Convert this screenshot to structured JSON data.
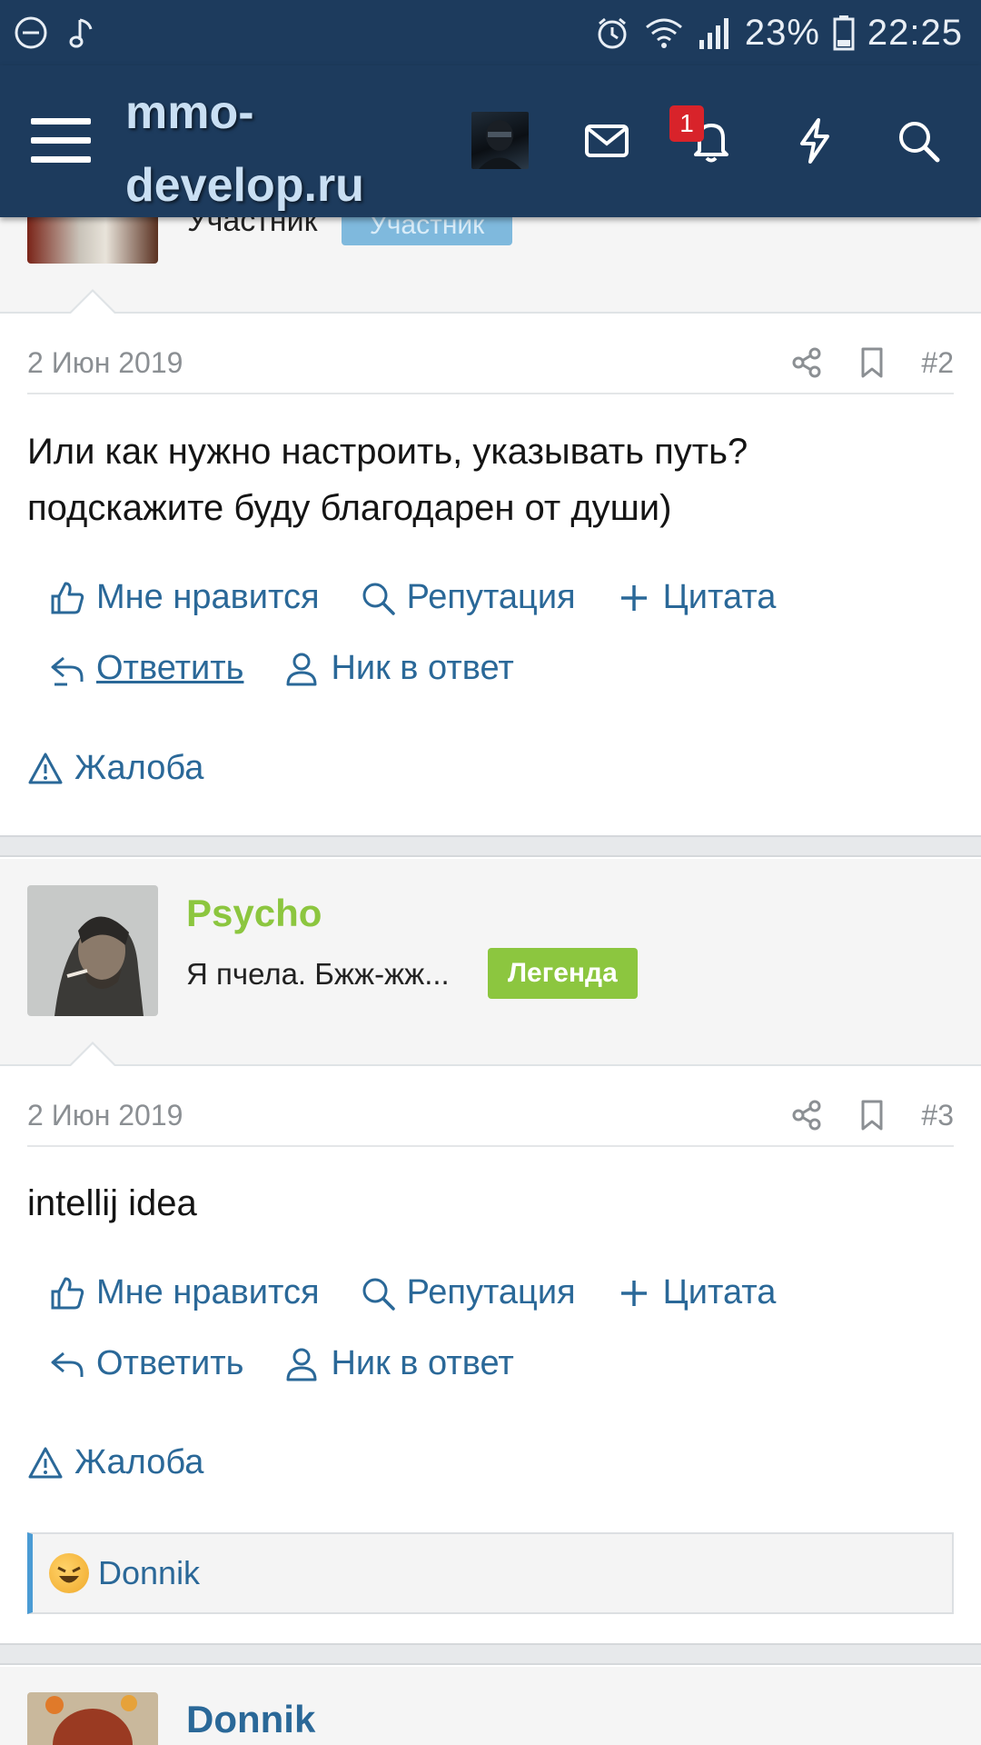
{
  "status_bar": {
    "battery": "23%",
    "time": "22:25"
  },
  "header": {
    "site_title": "mmo-develop.ru",
    "notification_count": "1",
    "icons": [
      "menu-icon",
      "avatar",
      "mail-icon",
      "bell-icon",
      "lightning-icon",
      "search-icon"
    ]
  },
  "prev_user": {
    "title": "Участник",
    "badge": "Участник"
  },
  "post2": {
    "date": "2 Июн 2019",
    "number": "#2",
    "body": "Или как нужно настроить, указывать путь? подскажите буду благодарен от души)",
    "like": "Мне нравится",
    "reputation": "Репутация",
    "quote": "Цитата",
    "reply": "Ответить",
    "nick_reply": "Ник в ответ",
    "report": "Жалоба"
  },
  "user3": {
    "name": "Psycho",
    "title": "Я пчела. Бжж-жж...",
    "badge": "Легенда",
    "name_color": "#8cc63f"
  },
  "post3": {
    "date": "2 Июн 2019",
    "number": "#3",
    "body": "intellij idea",
    "like": "Мне нравится",
    "reputation": "Репутация",
    "quote": "Цитата",
    "reply": "Ответить",
    "nick_reply": "Ник в ответ",
    "report": "Жалоба",
    "reaction_user": "Donnik"
  },
  "user4": {
    "name": "Donnik",
    "name_color": "#2a6898"
  },
  "colors": {
    "header_bg": "#1d3b5d",
    "link": "#2a6898",
    "legend_badge": "#8cc63f"
  }
}
